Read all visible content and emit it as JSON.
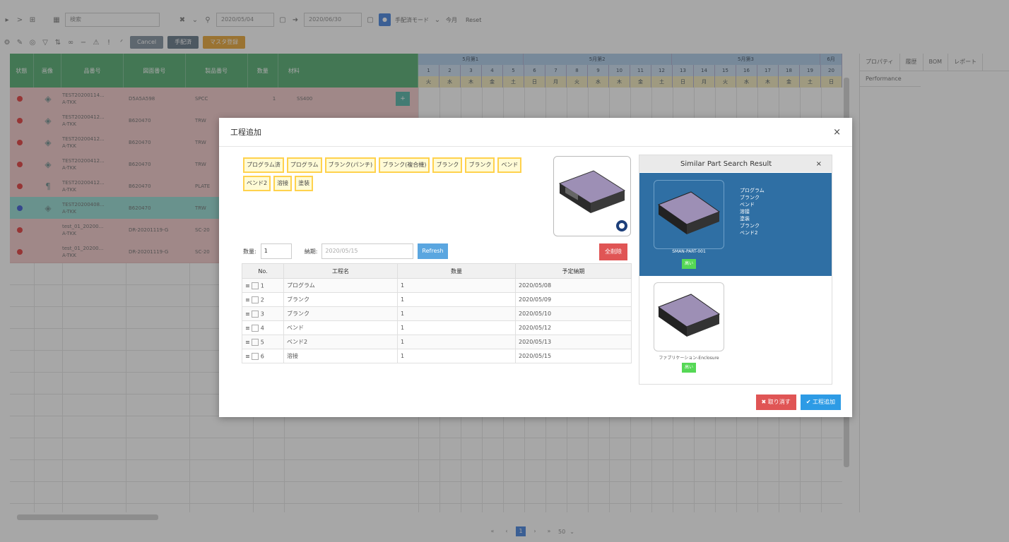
{
  "toolbar": {
    "nav_icons": [
      "▸",
      ">",
      "⊞"
    ],
    "grid_icon": "▦",
    "search_placeholder": "検索",
    "date_from": "2020/05/04",
    "date_to": "2020/06/30",
    "mode_label": "手配済モード",
    "today_label": "今月",
    "reset_label": "Reset",
    "cancel_label": "Cancel",
    "confirm_label": "手配済",
    "orange_label": "マスタ登録"
  },
  "grid": {
    "headers": [
      "状態",
      "画像",
      "品番号",
      "図面番号",
      "製品番号",
      "数量",
      "材料"
    ],
    "month_labels": [
      "5月第1",
      "5月第2",
      "5月第3",
      "6月"
    ],
    "days": [
      "1",
      "2",
      "3",
      "4",
      "5",
      "6",
      "7",
      "8",
      "9",
      "10",
      "11",
      "12",
      "13",
      "14",
      "15",
      "16",
      "17",
      "18",
      "19",
      "20"
    ],
    "dows": [
      "火",
      "水",
      "木",
      "金",
      "土",
      "日",
      "月",
      "火",
      "水",
      "木",
      "金",
      "土",
      "日",
      "月",
      "火",
      "水",
      "木",
      "金",
      "土",
      "日"
    ],
    "rows": [
      {
        "part": "TEST20200114...",
        "sub": "A-TKK",
        "drawing": "D5A5A598",
        "product": "SPCC",
        "qty": "1",
        "mat": "SS400",
        "sel": false
      },
      {
        "part": "TEST20200412...",
        "sub": "A-TKK",
        "drawing": "B620470",
        "product": "TRW",
        "qty": "",
        "mat": "",
        "sel": false
      },
      {
        "part": "TEST20200412...",
        "sub": "A-TKK",
        "drawing": "B620470",
        "product": "TRW",
        "qty": "",
        "mat": "",
        "sel": false
      },
      {
        "part": "TEST20200412...",
        "sub": "A-TKK",
        "drawing": "B620470",
        "product": "TRW",
        "qty": "",
        "mat": "",
        "sel": false
      },
      {
        "part": "TEST20200412...",
        "sub": "A-TKK",
        "drawing": "B620470",
        "product": "PLATE",
        "qty": "",
        "mat": "",
        "sel": false
      },
      {
        "part": "TEST20200408...",
        "sub": "A-TKK",
        "drawing": "B620470",
        "product": "TRW",
        "qty": "",
        "mat": "",
        "sel": true
      },
      {
        "part": "test_01_20200...",
        "sub": "A-TKK",
        "drawing": "DR-20201119-G",
        "product": "SC-20",
        "qty": "",
        "mat": "",
        "sel": false
      },
      {
        "part": "test_01_20200...",
        "sub": "A-TKK",
        "drawing": "DR-20201119-G",
        "product": "SC-20",
        "qty": "",
        "mat": "",
        "sel": false
      }
    ]
  },
  "right_panel": {
    "tabs": [
      "プロパティ",
      "履歴",
      "BOM",
      "レポート"
    ],
    "sub_tab": "Performance"
  },
  "modal": {
    "title": "工程追加",
    "close": "×",
    "tags": [
      "プログラム済",
      "プログラム",
      "ブランク(パンチ)",
      "ブランク(複合機)",
      "ブランク",
      "ブランク",
      "ベンド",
      "ベンド2",
      "溶接",
      "塗装"
    ],
    "qty_label": "数量:",
    "qty_value": "1",
    "due_label": "納期:",
    "due_placeholder": "2020/05/15",
    "refresh_label": "Refresh",
    "delete_label": "全削除",
    "table": {
      "headers": [
        "No.",
        "工程名",
        "数量",
        "予定納期"
      ],
      "rows": [
        {
          "no": "1",
          "name": "プログラム",
          "qty": "1",
          "date": "2020/05/08"
        },
        {
          "no": "2",
          "name": "ブランク",
          "qty": "1",
          "date": "2020/05/09"
        },
        {
          "no": "3",
          "name": "ブランク",
          "qty": "1",
          "date": "2020/05/10"
        },
        {
          "no": "4",
          "name": "ベンド",
          "qty": "1",
          "date": "2020/05/12"
        },
        {
          "no": "5",
          "name": "ベンド2",
          "qty": "1",
          "date": "2020/05/13"
        },
        {
          "no": "6",
          "name": "溶接",
          "qty": "1",
          "date": "2020/05/15"
        }
      ]
    },
    "similar": {
      "title": "Similar Part Search Result",
      "close": "×",
      "item1_name": "SMAN-PART-001",
      "item1_badge": "高い",
      "item1_processes": [
        "プログラム",
        "ブランク",
        "ベンド",
        "溶接",
        "塗装",
        "ブランク",
        "ベンド2"
      ],
      "item2_name": "ファブリケーション-Enclosure",
      "item2_badge": "高い"
    },
    "cancel_button": "✖ 取り消す",
    "add_button": "✔ 工程追加"
  },
  "pager": {
    "prev2": "«",
    "prev": "‹",
    "page": "1",
    "next": "›",
    "next2": "»",
    "per_page": "50"
  },
  "colors": {
    "header_green": "#4aa869",
    "row_red": "#f2c6c6",
    "row_selected": "#8fd9cf",
    "accent_blue": "#3b7ddd",
    "modal_blue": "#2f6fa4"
  }
}
